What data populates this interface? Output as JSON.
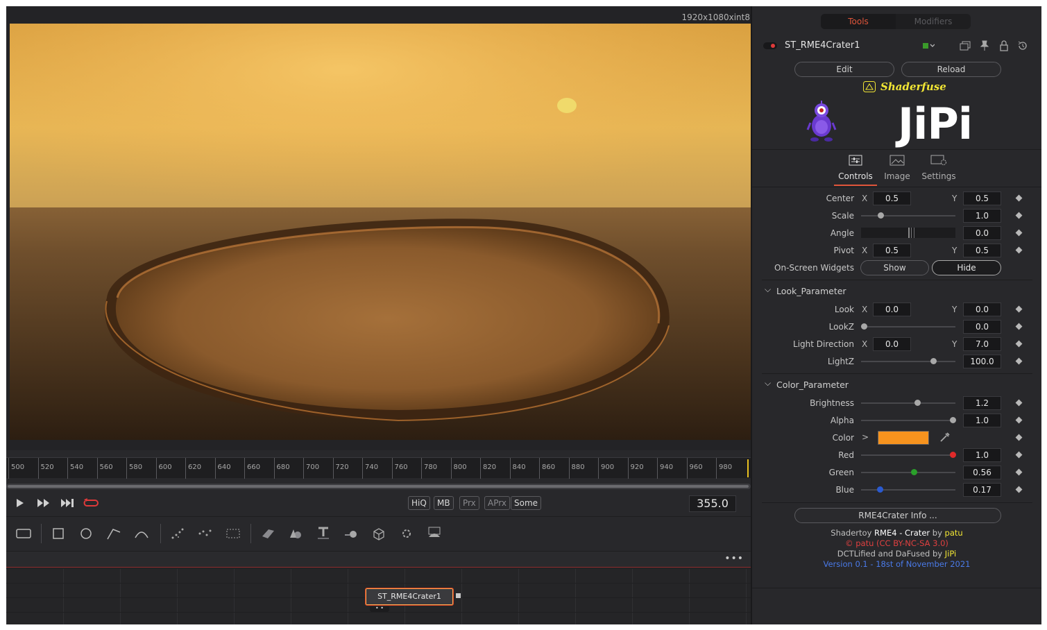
{
  "viewer": {
    "resolution": "1920x1080xint8",
    "ruler_ticks": [
      "500",
      "520",
      "540",
      "560",
      "580",
      "600",
      "620",
      "640",
      "660",
      "680",
      "700",
      "720",
      "740",
      "760",
      "780",
      "800",
      "820",
      "840",
      "860",
      "880",
      "900",
      "920",
      "940",
      "960",
      "980"
    ],
    "quality_buttons": [
      "HiQ",
      "MB",
      "Prx",
      "APrx",
      "Some"
    ],
    "current_frame": "355.0"
  },
  "flow": {
    "node_label": "ST_RME4Crater1",
    "menu": "•••"
  },
  "inspector": {
    "tabs": {
      "tools": "Tools",
      "modifiers": "Modifiers"
    },
    "tool_name": "ST_RME4Crater1",
    "edit_label": "Edit",
    "reload_label": "Reload",
    "banner_title": "Shaderfuse",
    "banner_brand": "JiPi",
    "subtabs": {
      "controls": "Controls",
      "image": "Image",
      "settings": "Settings"
    },
    "transform": {
      "center_label": "Center",
      "center_x": "0.5",
      "center_y": "0.5",
      "scale_label": "Scale",
      "scale": "1.0",
      "angle_label": "Angle",
      "angle": "0.0",
      "pivot_label": "Pivot",
      "pivot_x": "0.5",
      "pivot_y": "0.5",
      "widgets_label": "On-Screen Widgets",
      "show_label": "Show",
      "hide_label": "Hide",
      "axis_x": "X",
      "axis_y": "Y"
    },
    "look": {
      "title": "Look_Parameter",
      "look_label": "Look",
      "look_x": "0.0",
      "look_y": "0.0",
      "lookz_label": "LookZ",
      "lookz": "0.0",
      "light_label": "Light Direction",
      "light_x": "0.0",
      "light_y": "7.0",
      "lightz_label": "LightZ",
      "lightz": "100.0"
    },
    "color": {
      "title": "Color_Parameter",
      "brightness_label": "Brightness",
      "brightness": "1.2",
      "alpha_label": "Alpha",
      "alpha": "1.0",
      "color_label": "Color",
      "swatch": "#f7931e",
      "red_label": "Red",
      "red": "1.0",
      "green_label": "Green",
      "green": "0.56",
      "blue_label": "Blue",
      "blue": "0.17"
    },
    "info_button": "RME4Crater Info ...",
    "credits": {
      "l1_a": "Shadertoy ",
      "l1_b": "RME4 - Crater",
      "l1_c": " by ",
      "l1_d": "patu",
      "l2": "© patu (CC BY-NC-SA 3.0)",
      "l3_a": "DCTLified and DaFused by ",
      "l3_b": "JiPi",
      "l4": "Version 0.1 - 18st of November 2021"
    }
  }
}
